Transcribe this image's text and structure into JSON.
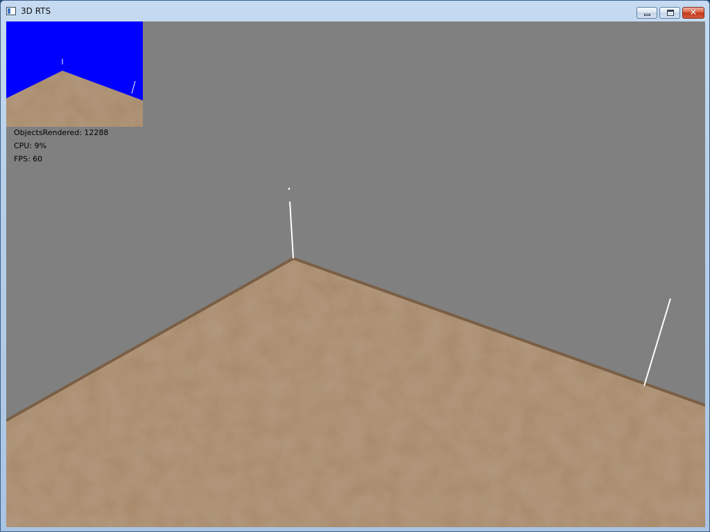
{
  "window": {
    "title": "3D RTS",
    "buttons": {
      "minimize_icon": "minimize-icon",
      "maximize_icon": "maximize-icon",
      "close_icon": "close-icon",
      "close_glyph": "✕"
    }
  },
  "hud": {
    "objects_rendered": "ObjectsRendered: 12288",
    "cpu": "CPU: 9%",
    "fps": "FPS: 60"
  },
  "colors": {
    "sky": "#808080",
    "minimap_sky": "#0000ff",
    "terrain": "#a88a6a",
    "terrain_edge": "#7a5f45",
    "unit_line": "#ffffff"
  }
}
